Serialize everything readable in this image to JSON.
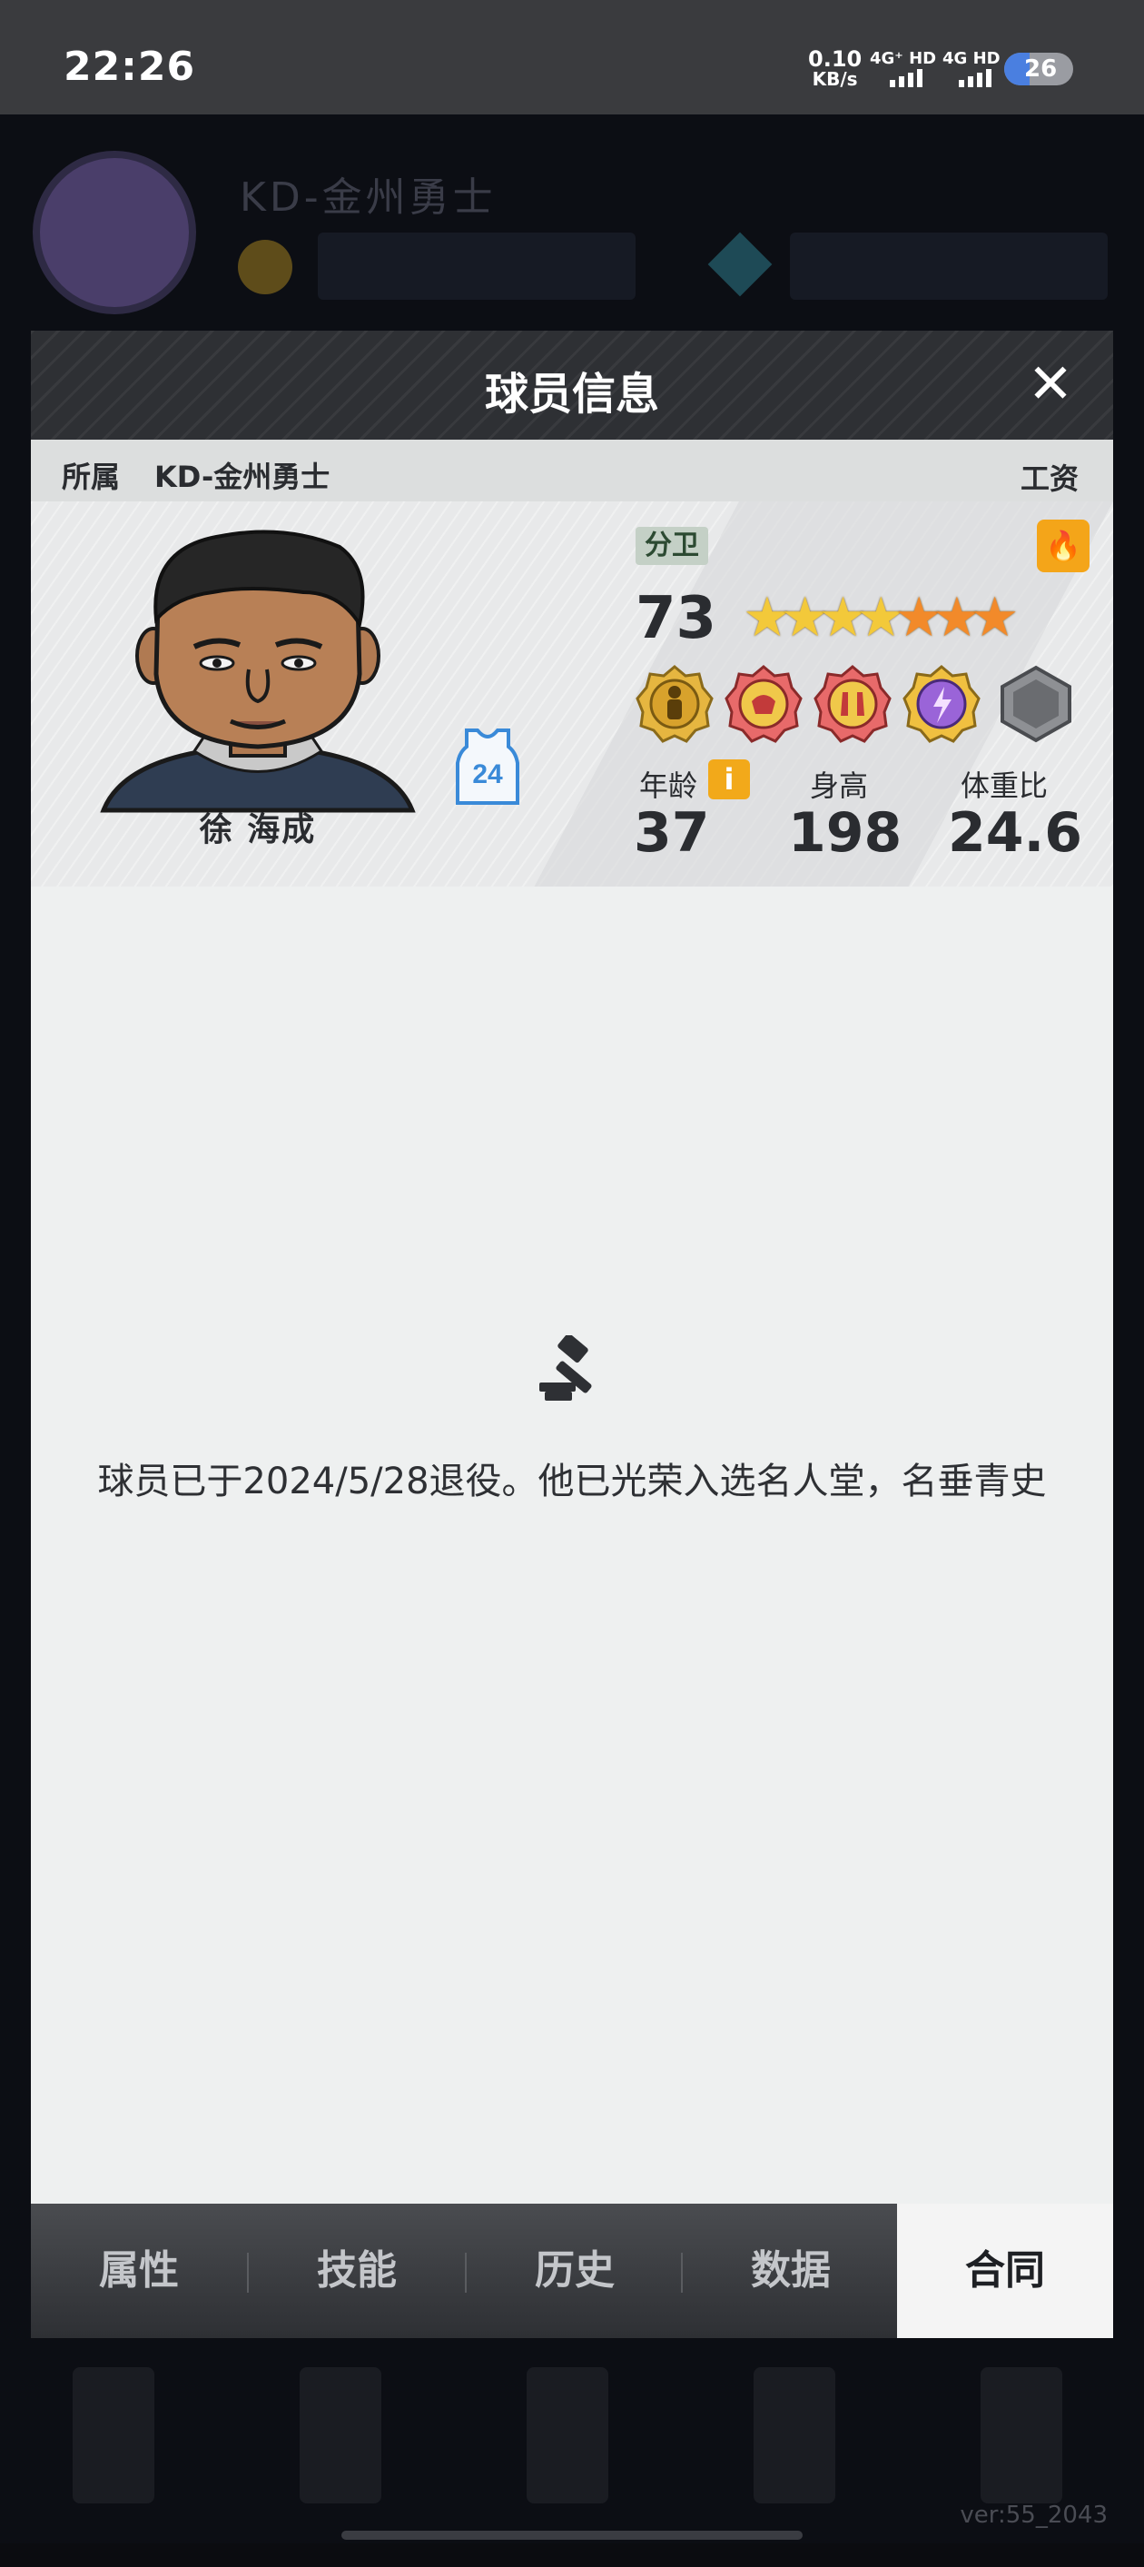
{
  "status_bar": {
    "time": "22:26",
    "net_speed_value": "0.10",
    "net_speed_unit": "KB/s",
    "sim1": "4G⁺ HD",
    "sim2": "4G HD",
    "battery": "26"
  },
  "background": {
    "team_name": "KD-金州勇士",
    "version": "ver:55_2043"
  },
  "modal": {
    "title": "球员信息",
    "close_label": "✕",
    "team_label": "所属",
    "team_name": "KD-金州勇士",
    "salary_label": "工资"
  },
  "player": {
    "name": "徐 海成",
    "jersey_number": "24",
    "position": "分卫",
    "overall": "73",
    "stars": 7,
    "gold_stars": 4,
    "age_label": "年龄",
    "age": "37",
    "height_label": "身高",
    "height": "198",
    "weight_ratio_label": "体重比",
    "weight_ratio": "24.6",
    "info_icon_label": "i",
    "fire_icon": "🔥"
  },
  "contract": {
    "message": "球员已于2024/5/28退役。他已光荣入选名人堂，名垂青史"
  },
  "tabs": [
    {
      "label": "属性"
    },
    {
      "label": "技能"
    },
    {
      "label": "历史"
    },
    {
      "label": "数据"
    },
    {
      "label": "合同"
    }
  ],
  "active_tab": "合同",
  "colors": {
    "header_bg": "#2e3034",
    "accent_orange": "#f2a91a",
    "modal_bg": "#eef0f0"
  }
}
